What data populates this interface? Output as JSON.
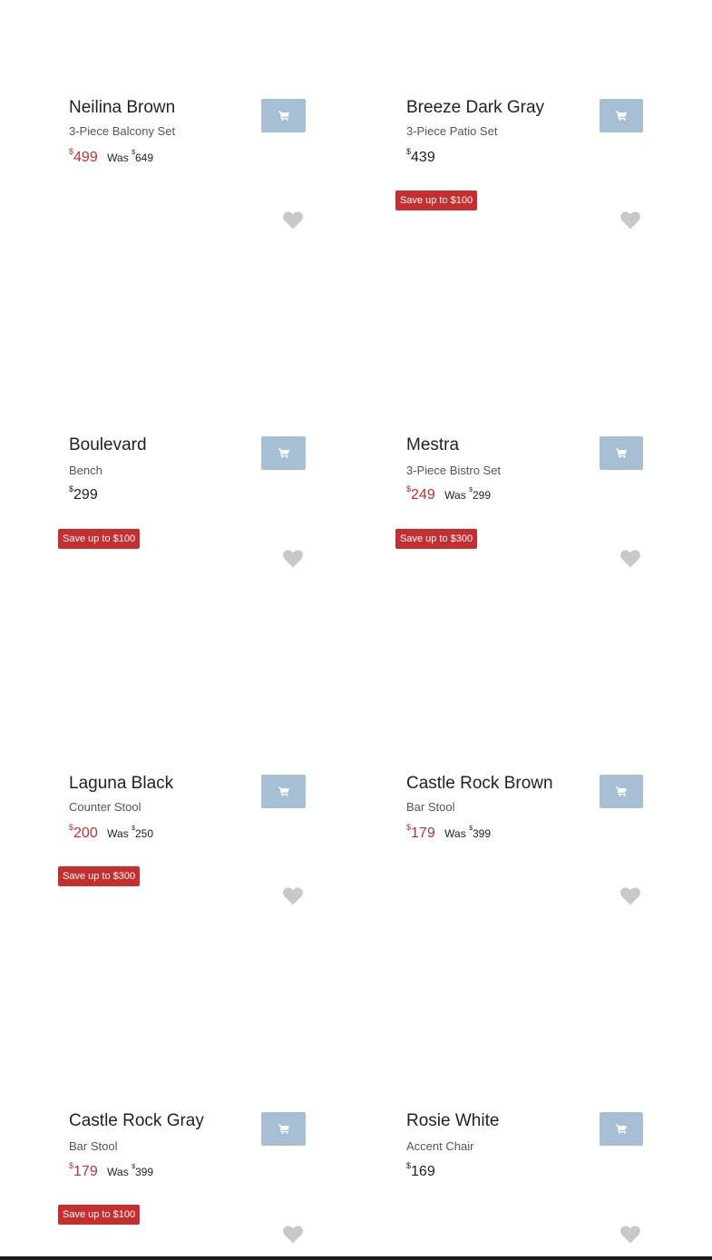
{
  "colors": {
    "sale": "#c62f2f",
    "cart_button": "#a7bfd4",
    "heart": "#c8c8c8"
  },
  "products": [
    {
      "title": "Neilina Brown",
      "subtitle": "3-Piece Balcony Set",
      "currency": "$",
      "price": "499",
      "was_label": "Was",
      "was_price": "649",
      "on_sale": true,
      "badge": ""
    },
    {
      "title": "Breeze Dark Gray",
      "subtitle": "3-Piece Patio Set",
      "currency": "$",
      "price": "439",
      "was_label": "",
      "was_price": "",
      "on_sale": false,
      "badge": ""
    },
    {
      "title": "Boulevard",
      "subtitle": "Bench",
      "currency": "$",
      "price": "299",
      "was_label": "",
      "was_price": "",
      "on_sale": false,
      "badge": ""
    },
    {
      "title": "Mestra",
      "subtitle": "3-Piece Bistro Set",
      "currency": "$",
      "price": "249",
      "was_label": "Was",
      "was_price": "299",
      "on_sale": true,
      "badge": "Save up to $100"
    },
    {
      "title": "Laguna Black",
      "subtitle": "Counter Stool",
      "currency": "$",
      "price": "200",
      "was_label": "Was",
      "was_price": "250",
      "on_sale": true,
      "badge": "Save up to $100"
    },
    {
      "title": "Castle Rock Brown",
      "subtitle": "Bar Stool",
      "currency": "$",
      "price": "179",
      "was_label": "Was",
      "was_price": "399",
      "on_sale": true,
      "badge": "Save up to $300"
    },
    {
      "title": "Castle Rock Gray",
      "subtitle": "Bar Stool",
      "currency": "$",
      "price": "179",
      "was_label": "Was",
      "was_price": "399",
      "on_sale": true,
      "badge": "Save up to $300"
    },
    {
      "title": "Rosie White",
      "subtitle": "Accent Chair",
      "currency": "$",
      "price": "169",
      "was_label": "",
      "was_price": "",
      "on_sale": false,
      "badge": ""
    }
  ],
  "next_row_badge": "Save up to $100",
  "icons": {
    "cart": "shopping-cart-icon",
    "wishlist": "heart-icon"
  }
}
